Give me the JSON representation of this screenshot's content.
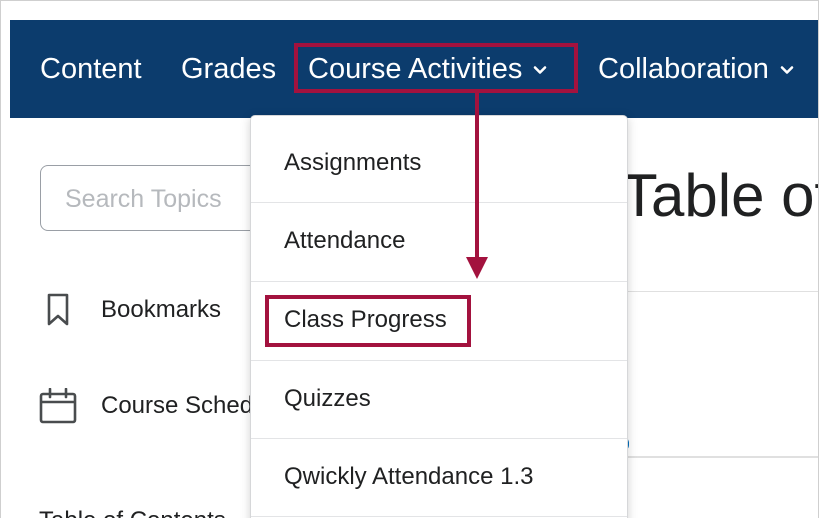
{
  "nav": {
    "content_label": "Content",
    "grades_label": "Grades",
    "course_activities_label": "Course Activities",
    "collaboration_label": "Collaboration"
  },
  "sidebar": {
    "search_placeholder": "Search Topics",
    "items": [
      {
        "label": "Bookmarks",
        "icon": "bookmark-icon"
      },
      {
        "label": "Course Schedule",
        "icon": "calendar-icon"
      }
    ],
    "toc_label": "Table of Contents"
  },
  "main": {
    "heading": "Table of Contents"
  },
  "dropdown": {
    "items": [
      {
        "label": "Assignments"
      },
      {
        "label": "Attendance"
      },
      {
        "label": "Class Progress"
      },
      {
        "label": "Quizzes"
      },
      {
        "label": "Qwickly Attendance 1.3"
      }
    ]
  },
  "colors": {
    "nav_background": "#0c3c6d",
    "annotation": "#a3123e",
    "accent": "#006fbf"
  }
}
